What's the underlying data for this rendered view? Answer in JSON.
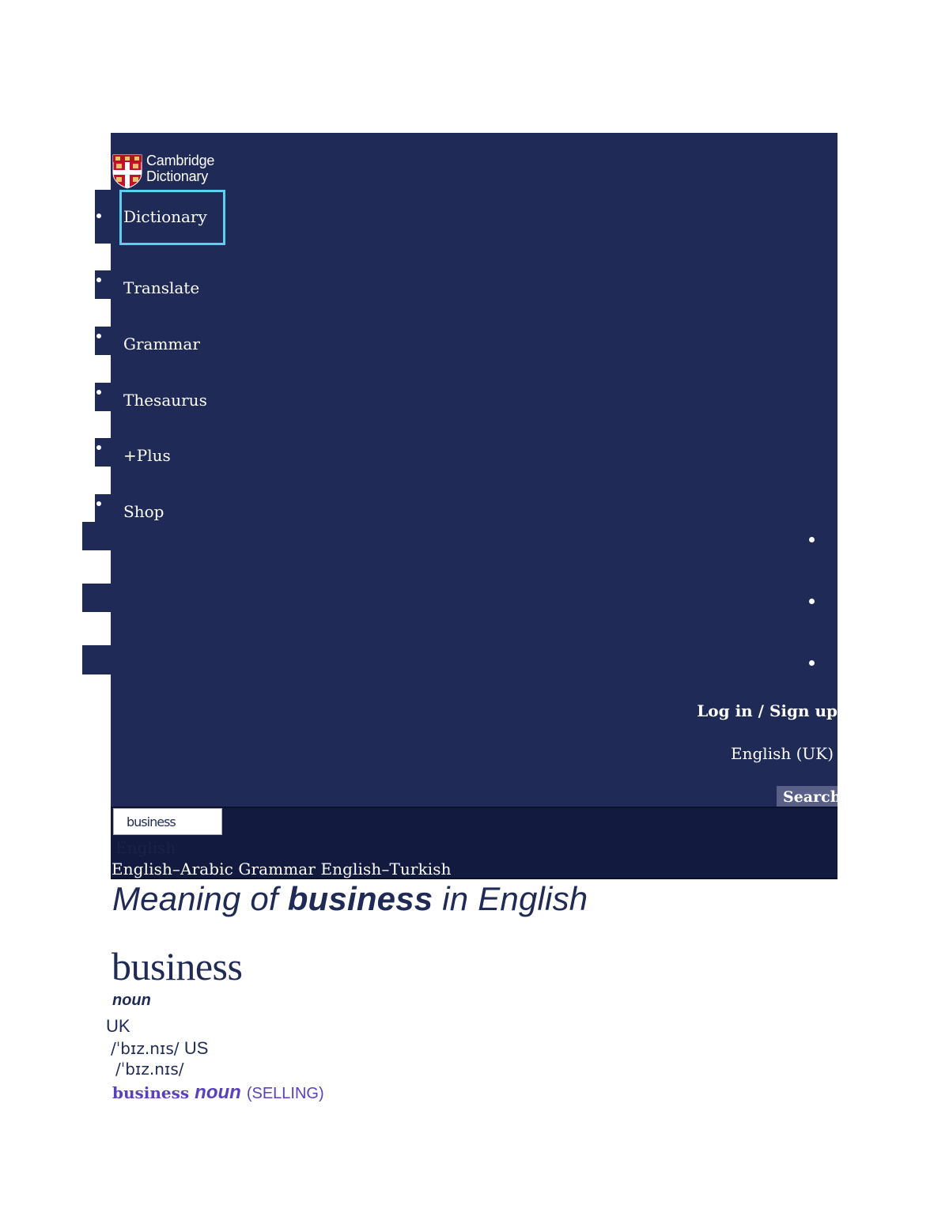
{
  "brand": {
    "line1": "Cambridge",
    "line2": "Dictionary"
  },
  "nav": {
    "items": [
      {
        "label": "Dictionary"
      },
      {
        "label": "Translate"
      },
      {
        "label": "Grammar"
      },
      {
        "label": "Thesaurus"
      },
      {
        "label": "+Plus"
      },
      {
        "label": "Shop"
      }
    ],
    "active": "Dictionary"
  },
  "header": {
    "login_label": "Log in / Sign up",
    "language_label": "English (UK)",
    "search_button": "Search"
  },
  "search": {
    "value": "business",
    "dataset_hint": "English",
    "quick_links": [
      "English–Arabic",
      "Grammar",
      "English–Turkish"
    ]
  },
  "entry": {
    "title_prefix": "Meaning of",
    "title_word": "business",
    "title_suffix": "in English",
    "headword": "business",
    "pos": "noun",
    "uk_label": "UK",
    "uk_ipa": "/ˈbɪz.nɪs/",
    "us_label": "US",
    "us_ipa": "/ˈbɪz.nɪs/",
    "sense_word": "business",
    "sense_pos": "noun",
    "sense_guide": "SELLING"
  },
  "colors": {
    "header_bg": "#1f2a56",
    "search_bar_bg": "#131a40",
    "active_outline": "#5bd0ee",
    "text_primary": "#1f2a56",
    "sense_color": "#5a3fc6",
    "search_button_bg": "#595f86"
  }
}
